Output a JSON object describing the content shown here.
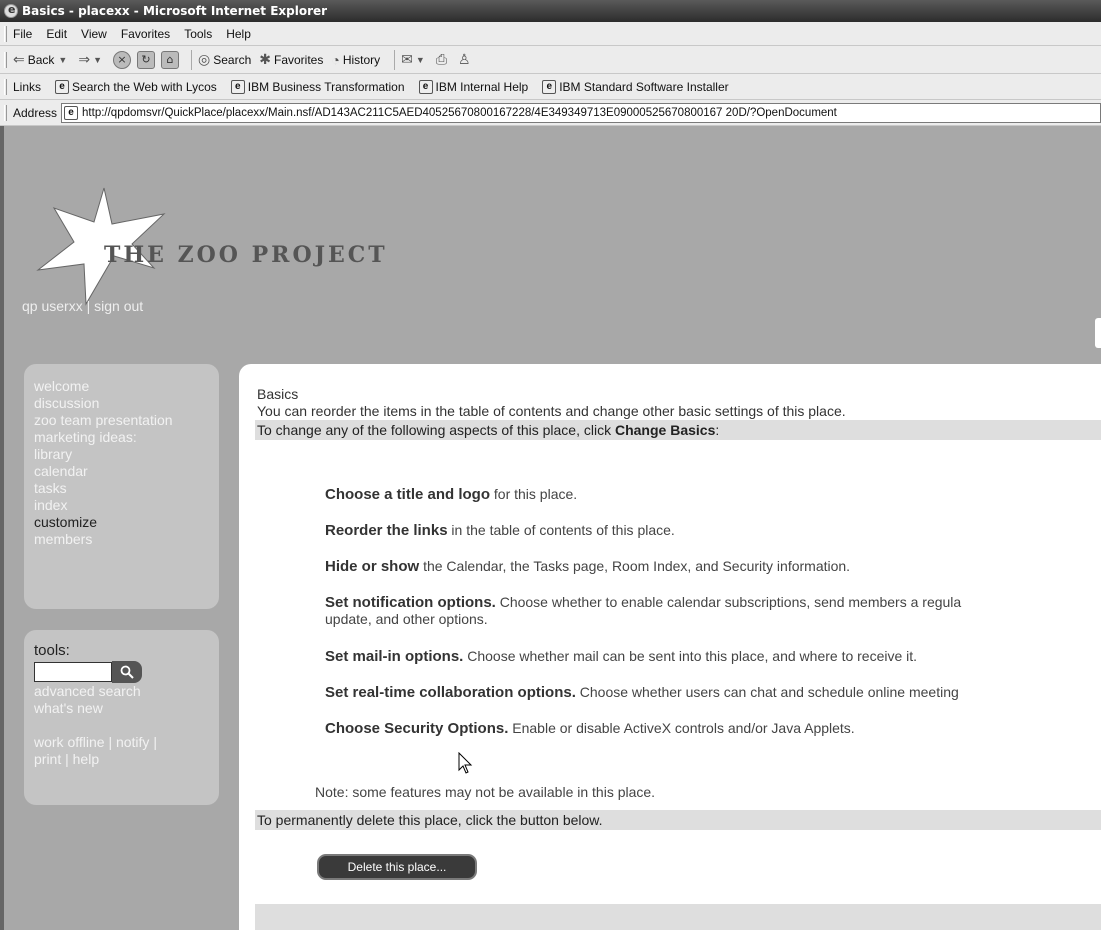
{
  "window": {
    "title": "Basics - placexx - Microsoft Internet Explorer"
  },
  "menu": [
    "File",
    "Edit",
    "View",
    "Favorites",
    "Tools",
    "Help"
  ],
  "toolbar": {
    "back": "Back",
    "forward_glyph": "⇒",
    "search": "Search",
    "favorites": "Favorites",
    "history": "History"
  },
  "links_bar": {
    "label": "Links",
    "items": [
      "Search the Web with Lycos",
      "IBM Business Transformation",
      "IBM Internal Help",
      "IBM Standard Software Installer"
    ]
  },
  "address_bar": {
    "label": "Address",
    "url": "http://qpdomsvr/QuickPlace/placexx/Main.nsf/AD143AC211C5AED40525670800167228/4E349349713E09000525670800167 20D/?OpenDocument"
  },
  "banner": {
    "logo_text": "THE ZOO PROJECT",
    "user": "qp userxx",
    "separator": " | ",
    "sign_out": "sign out"
  },
  "nav": {
    "items": [
      {
        "label": "welcome",
        "active": false
      },
      {
        "label": "discussion",
        "active": false
      },
      {
        "label": "zoo team presentation",
        "active": false
      },
      {
        "label": "marketing ideas:",
        "active": false
      },
      {
        "label": "library",
        "active": false
      },
      {
        "label": "calendar",
        "active": false
      },
      {
        "label": "tasks",
        "active": false
      },
      {
        "label": "index",
        "active": false
      },
      {
        "label": "customize",
        "active": true
      },
      {
        "label": "members",
        "active": false
      }
    ]
  },
  "tools": {
    "label": "tools:",
    "search_value": "",
    "advanced_search": "advanced search",
    "whats_new": "what's new",
    "line1": "work offline | notify |",
    "line2": "print | help"
  },
  "main": {
    "title": "Basics",
    "intro": "You can reorder the items in the table of contents and change other basic settings of this place.",
    "change_prefix": "To change any of the following aspects of this place, click ",
    "change_link": "Change Basics",
    "change_suffix": ":",
    "options": [
      {
        "bold": "Choose a title and logo",
        "text": " for this place.",
        "text2": ""
      },
      {
        "bold": "Reorder the links",
        "text": " in the table of contents of this place.",
        "text2": ""
      },
      {
        "bold": "Hide or show",
        "text": " the Calendar, the Tasks page, Room Index, and Security information.",
        "text2": ""
      },
      {
        "bold": "Set notification options.",
        "text": " Choose whether to enable calendar subscriptions, send members a regula",
        "text2": "update, and other options."
      },
      {
        "bold": "Set mail-in options.",
        "text": " Choose whether mail can be sent into this place, and where to receive it.",
        "text2": ""
      },
      {
        "bold": "Set real-time collaboration options.",
        "text": " Choose whether users can chat and schedule online meeting",
        "text2": ""
      },
      {
        "bold": "Choose Security Options.",
        "text": " Enable or disable ActiveX controls and/or Java Applets.",
        "text2": ""
      }
    ],
    "note": "Note: some features may not be available in this place.",
    "delete_text": "To permanently delete this place, click the button below.",
    "delete_button": "Delete this place..."
  }
}
